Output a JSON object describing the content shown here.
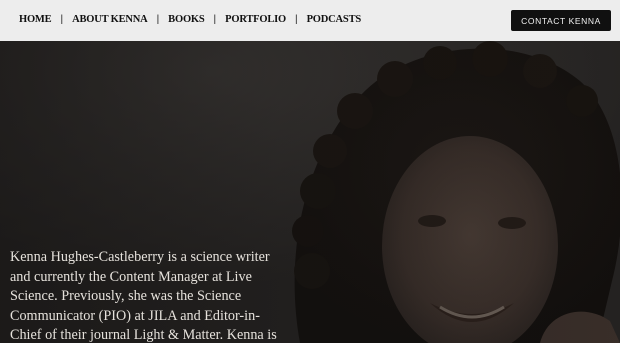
{
  "nav": {
    "items": [
      {
        "label": "HOME"
      },
      {
        "label": "ABOUT KENNA"
      },
      {
        "label": "BOOKS"
      },
      {
        "label": "PORTFOLIO"
      },
      {
        "label": "PODCASTS"
      }
    ],
    "separator": "|",
    "contact_label": "CONTACT KENNA"
  },
  "hero": {
    "bio": "Kenna Hughes-Castleberry is a science writer and currently the Content Manager at Live Science. Previously, she was the Science Communicator (PIO) at JILA and Editor-in-Chief of their journal Light & Matter. Kenna is"
  },
  "colors": {
    "header_bg": "#ededed",
    "button_bg": "#101010",
    "hero_text": "#e6e2dc"
  }
}
